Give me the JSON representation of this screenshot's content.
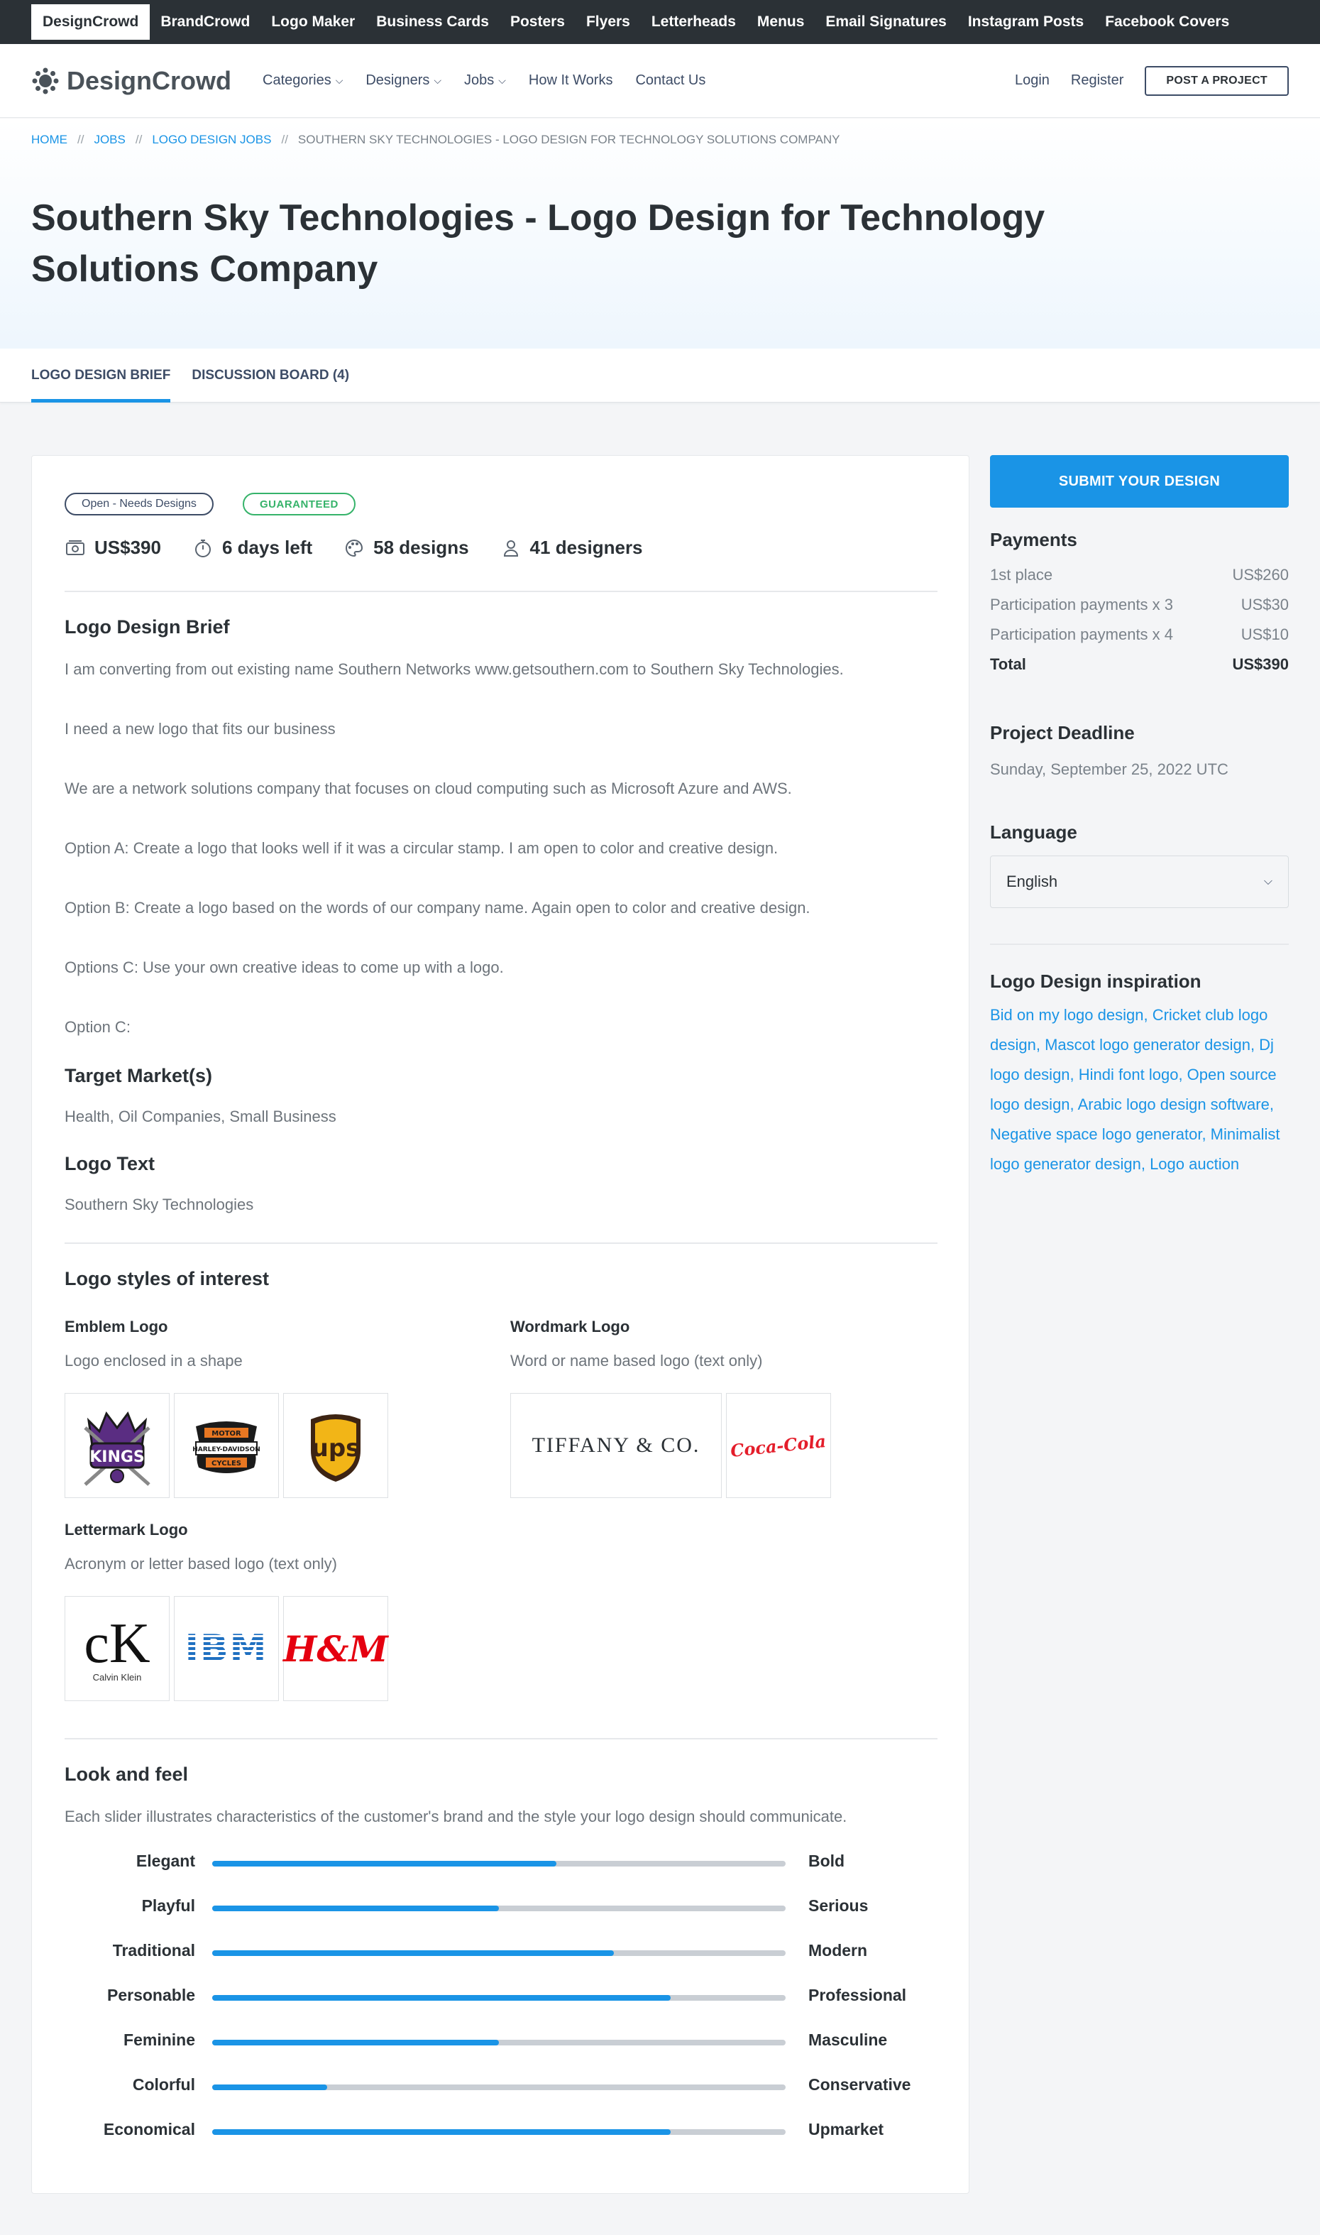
{
  "topbar": {
    "items": [
      "DesignCrowd",
      "BrandCrowd",
      "Logo Maker",
      "Business Cards",
      "Posters",
      "Flyers",
      "Letterheads",
      "Menus",
      "Email Signatures",
      "Instagram Posts",
      "Facebook Covers"
    ]
  },
  "header": {
    "logo_text": "DesignCrowd",
    "nav": [
      "Categories",
      "Designers",
      "Jobs",
      "How It Works",
      "Contact Us"
    ],
    "login": "Login",
    "register": "Register",
    "post_button": "POST A PROJECT"
  },
  "breadcrumb": [
    "HOME",
    "JOBS",
    "LOGO DESIGN JOBS",
    "SOUTHERN SKY TECHNOLOGIES - LOGO DESIGN FOR TECHNOLOGY SOLUTIONS COMPANY"
  ],
  "breadcrumb_sep": "//",
  "page_title": "Southern Sky Technologies - Logo Design for Technology Solutions Company",
  "tabs": [
    "LOGO DESIGN BRIEF",
    "DISCUSSION BOARD (4)"
  ],
  "brief": {
    "status": "Open - Needs Designs",
    "guaranteed": "GUARANTEED",
    "prize": "US$390",
    "time_left": "6 days left",
    "designs": "58 designs",
    "designers": "41 designers",
    "section_title": "Logo Design Brief",
    "paragraphs": [
      "I am converting from out existing name Southern Networks www.getsouthern.com to Southern Sky Technologies.",
      "I need a new logo that fits our business",
      "We are a network solutions company that focuses on cloud computing such as Microsoft Azure and AWS.",
      "Option A: Create a logo that looks well if it was a circular stamp. I am open to color and creative design.",
      "Option B: Create a logo based on the words of our company name. Again open to color and creative design.",
      "Options C: Use your own creative ideas to come up with a logo.",
      "Option C:"
    ],
    "target_title": "Target Market(s)",
    "target_text": "Health, Oil Companies, Small Business",
    "logo_text_title": "Logo Text",
    "logo_text_value": "Southern Sky Technologies"
  },
  "styles": {
    "title": "Logo styles of interest",
    "emblem": {
      "name": "Emblem Logo",
      "desc": "Logo enclosed in a shape"
    },
    "wordmark": {
      "name": "Wordmark Logo",
      "desc": "Word or name based logo (text only)"
    },
    "lettermark": {
      "name": "Lettermark Logo",
      "desc": "Acronym or letter based logo (text only)"
    },
    "examples": {
      "kings": "KINGS",
      "harley": [
        "MOTOR",
        "HARLEY-DAVIDSON",
        "CYCLES"
      ],
      "ups": "ups",
      "tiffany": "TIFFANY & CO.",
      "cocacola": "Coca-Cola",
      "ck_mark": "cK",
      "ck_name": "Calvin Klein",
      "ibm": "IBM",
      "hm": "H&M"
    }
  },
  "look": {
    "title": "Look and feel",
    "desc": "Each slider illustrates characteristics of the customer's brand and the style your logo design should communicate.",
    "sliders": [
      {
        "left": "Elegant",
        "right": "Bold",
        "value": 0.6
      },
      {
        "left": "Playful",
        "right": "Serious",
        "value": 0.5
      },
      {
        "left": "Traditional",
        "right": "Modern",
        "value": 0.7
      },
      {
        "left": "Personable",
        "right": "Professional",
        "value": 0.8
      },
      {
        "left": "Feminine",
        "right": "Masculine",
        "value": 0.5
      },
      {
        "left": "Colorful",
        "right": "Conservative",
        "value": 0.2
      },
      {
        "left": "Economical",
        "right": "Upmarket",
        "value": 0.8
      }
    ]
  },
  "sidebar": {
    "submit": "SUBMIT YOUR DESIGN",
    "payments_title": "Payments",
    "payments": [
      {
        "label": "1st place",
        "amount": "US$260"
      },
      {
        "label": "Participation payments x 3",
        "amount": "US$30"
      },
      {
        "label": "Participation payments x 4",
        "amount": "US$10"
      }
    ],
    "total_label": "Total",
    "total_amount": "US$390",
    "deadline_title": "Project Deadline",
    "deadline": "Sunday, September 25, 2022 UTC",
    "language_title": "Language",
    "language": "English",
    "inspiration_title": "Logo Design inspiration",
    "inspiration_links": [
      "Bid on my logo design",
      "Cricket club logo design",
      "Mascot logo generator design",
      "Dj logo design",
      "Hindi font logo",
      "Open source logo design",
      "Arabic logo design software",
      "Negative space logo generator",
      "Minimalist logo generator design",
      "Logo auction"
    ]
  },
  "colors": {
    "accent": "#1a94e6",
    "topbar": "#2b3136",
    "guaranteed": "#36b36a",
    "track": "#c9ced4"
  }
}
